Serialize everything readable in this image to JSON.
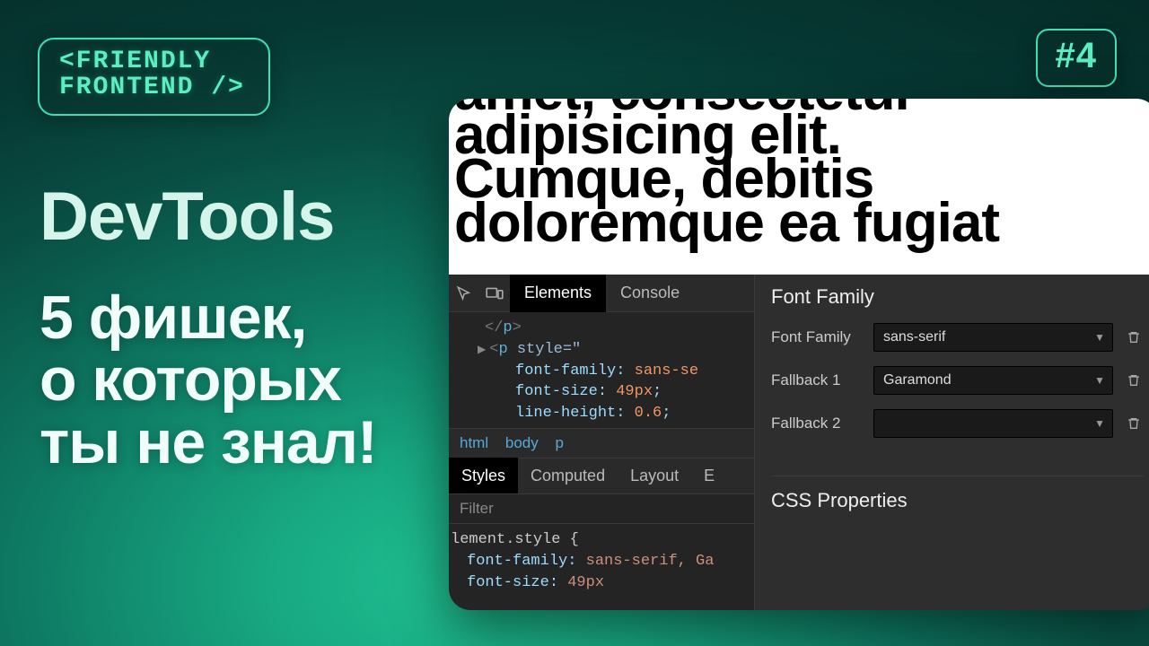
{
  "branding": {
    "logo_line1": "<FRIENDLY",
    "logo_line2": "FRONTEND />",
    "episode": "#4"
  },
  "headline": {
    "title": "DevTools",
    "subtitle": "5 фишек,\nо которых\nты не знал!"
  },
  "preview": {
    "lorem": "amet, consectetur\nadipisicing elit.\nCumque, debitis\ndoloremque ea fugiat"
  },
  "devtools": {
    "tabs": {
      "elements": "Elements",
      "console": "Console"
    },
    "dom": {
      "closing_p": "</p>",
      "open_tag": "<p",
      "style_attr": "style=\"",
      "rules": [
        {
          "prop": "font-family",
          "val": "sans-se"
        },
        {
          "prop": "font-size",
          "val": "49px"
        },
        {
          "prop": "line-height",
          "val": "0.6"
        }
      ]
    },
    "breadcrumb": [
      "html",
      "body",
      "p"
    ],
    "subtabs": [
      "Styles",
      "Computed",
      "Layout",
      "E"
    ],
    "filter_placeholder": "Filter",
    "styles_panel": {
      "selector": "lement.style {",
      "rules": [
        {
          "prop": "font-family",
          "val": "sans-serif, Ga"
        },
        {
          "prop": "font-size",
          "val": "49px"
        }
      ]
    }
  },
  "font_panel": {
    "heading": "Font Family",
    "rows": [
      {
        "label": "Font Family",
        "value": "sans-serif"
      },
      {
        "label": "Fallback 1",
        "value": "Garamond"
      },
      {
        "label": "Fallback 2",
        "value": ""
      }
    ],
    "css_section": "CSS Properties"
  }
}
